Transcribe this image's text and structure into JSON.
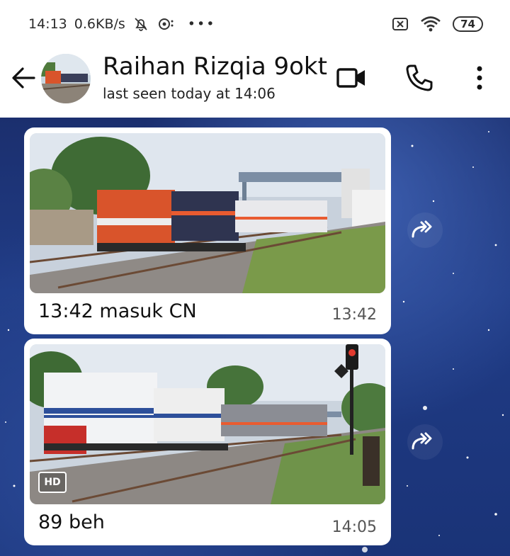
{
  "status_bar": {
    "time": "14:13",
    "speed": "0.6KB/s",
    "more": "•••",
    "battery": "74"
  },
  "header": {
    "contact_name": "Raihan Rizqia 9okt",
    "last_seen": "last seen today at 14:06",
    "icons": [
      "back-arrow-icon",
      "video-call-icon",
      "phone-icon",
      "more-vert-icon"
    ]
  },
  "messages": [
    {
      "caption": "13:42 masuk CN",
      "time": "13:42"
    },
    {
      "caption": "89 beh",
      "time": "14:05",
      "badge": "HD"
    }
  ],
  "colors": {
    "accent": "#2b2b2b",
    "chat_background": "#1e3a82",
    "bubble": "#ffffff"
  }
}
